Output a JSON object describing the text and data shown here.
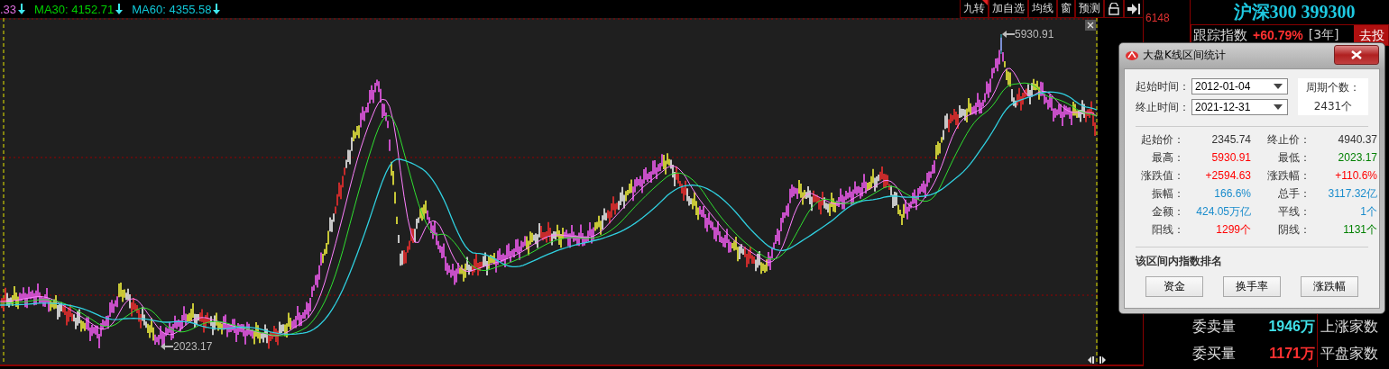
{
  "indicator_bar": [
    {
      "text": ".33",
      "color": "#e070e0"
    },
    {
      "text": "MA30: 4152.71",
      "color": "#00d000"
    },
    {
      "text": "MA60: 4355.58",
      "color": "#10c8d8"
    }
  ],
  "toolbar": [
    {
      "kind": "text",
      "label": "九转",
      "flagged": true
    },
    {
      "kind": "text",
      "label": "加自选",
      "flagged": false
    },
    {
      "kind": "text",
      "label": "均线",
      "flagged": false
    },
    {
      "kind": "text",
      "label": "窗",
      "flagged": false
    },
    {
      "kind": "text",
      "label": "预测",
      "flagged": false
    },
    {
      "kind": "lock"
    },
    {
      "kind": "exit"
    }
  ],
  "chart": {
    "high_label": "5930.91",
    "low_label": "2023.17",
    "price_label": "6148"
  },
  "quote_panel": {
    "title": "沪深300 399300",
    "tracking": {
      "label": "跟踪指数",
      "change": "+60.79%",
      "period": "[3年]",
      "button": "去投"
    },
    "rows": [
      {
        "label": "委卖量",
        "value": "1946万",
        "color": "#40e0e8",
        "label_2": "上涨家数"
      },
      {
        "label": "委买量",
        "value": "1171万",
        "color": "#ff3030",
        "label_2": "平盘家数"
      }
    ]
  },
  "dialog": {
    "title": "大盘K线区间统计",
    "start_label": "起始时间：",
    "start_value": "2012-01-04",
    "end_label": "终止时间：",
    "end_value": "2021-12-31",
    "period_label": "周期个数：",
    "period_count": "2431个",
    "stats": [
      {
        "label": "起始价：",
        "value": "2345.74",
        "color": "#333333"
      },
      {
        "label": "终止价：",
        "value": "4940.37",
        "color": "#333333"
      },
      {
        "label": "最高：",
        "value": "5930.91",
        "color": "#ff0000"
      },
      {
        "label": "最低：",
        "value": "2023.17",
        "color": "#008000"
      },
      {
        "label": "涨跌值：",
        "value": "+2594.63",
        "color": "#ff0000"
      },
      {
        "label": "涨跌幅：",
        "value": "+110.6%",
        "color": "#ff0000"
      },
      {
        "label": "振幅：",
        "value": "166.6%",
        "color": "#1a8ccc"
      },
      {
        "label": "总手：",
        "value": "3117.32亿",
        "color": "#1a8ccc"
      },
      {
        "label": "金额：",
        "value": "424.05万亿",
        "color": "#1a8ccc"
      },
      {
        "label": "平线：",
        "value": "1个",
        "color": "#1a8ccc"
      },
      {
        "label": "阳线：",
        "value": "1299个",
        "color": "#ff0000"
      },
      {
        "label": "阴线：",
        "value": "1131个",
        "color": "#008000"
      }
    ],
    "ranking_title": "该区间内指数排名",
    "buttons": [
      "资金",
      "换手率",
      "涨跌幅"
    ]
  }
}
